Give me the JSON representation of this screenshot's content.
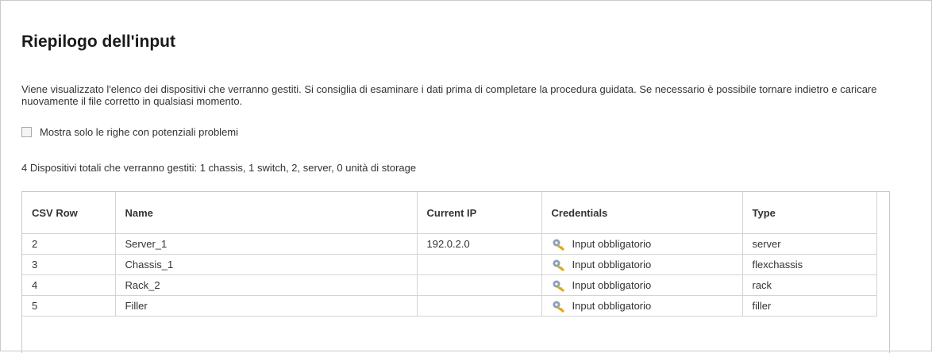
{
  "page": {
    "title": "Riepilogo dell'input",
    "description": "Viene visualizzato l'elenco dei dispositivi che verranno gestiti. Si consiglia di esaminare i dati prima di completare la procedura guidata. Se necessario è possibile tornare indietro e caricare nuovamente il file corretto in qualsiasi momento.",
    "filter_label": "Mostra solo le righe con potenziali problemi",
    "filter_checked": false,
    "summary": "4 Dispositivi totali che verranno gestiti: 1 chassis, 1 switch, 2, server, 0 unità di storage"
  },
  "table": {
    "headers": [
      "CSV Row",
      "Name",
      "Current IP",
      "Credentials",
      "Type"
    ],
    "rows": [
      {
        "csv_row": "2",
        "name": "Server_1",
        "ip": "192.0.2.0",
        "credentials": "Input obbligatorio",
        "type": "server"
      },
      {
        "csv_row": "3",
        "name": "Chassis_1",
        "ip": "",
        "credentials": "Input obbligatorio",
        "type": "flexchassis"
      },
      {
        "csv_row": "4",
        "name": "Rack_2",
        "ip": "",
        "credentials": "Input obbligatorio",
        "type": "rack"
      },
      {
        "csv_row": "5",
        "name": "Filler",
        "ip": "",
        "credentials": "Input obbligatorio",
        "type": "filler"
      }
    ]
  },
  "icons": {
    "credential_icon": "key-edit-icon",
    "credential_colors": [
      "#e1a81f",
      "#8aa0b7"
    ]
  }
}
